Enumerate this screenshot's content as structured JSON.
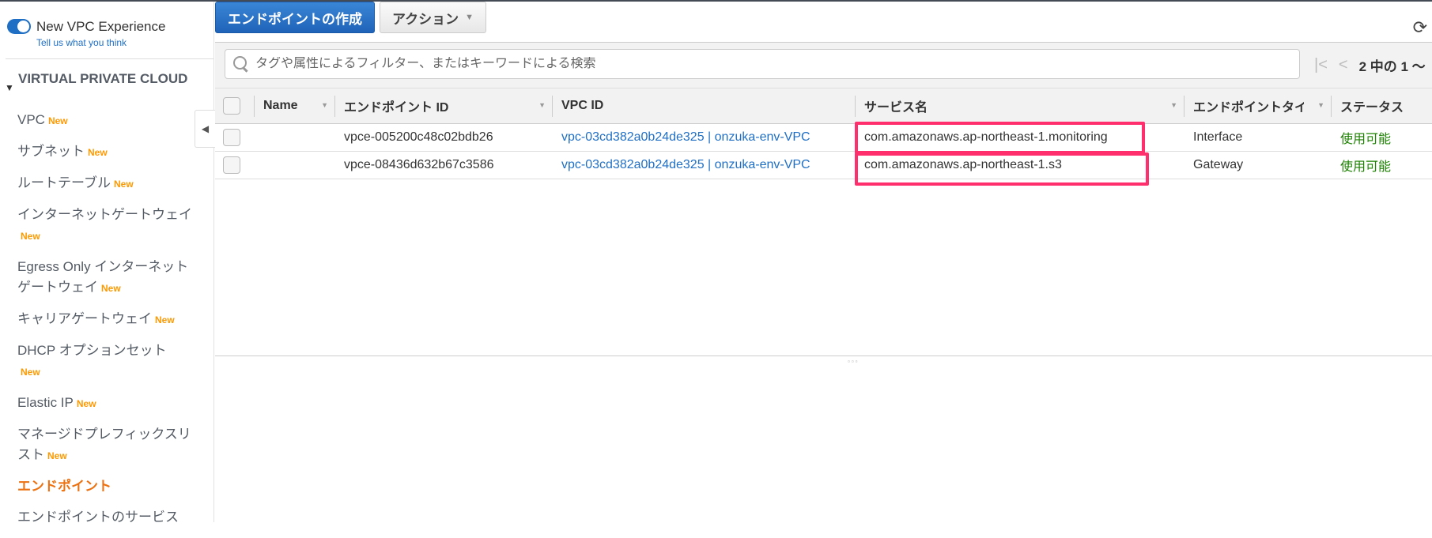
{
  "sidebar": {
    "experience_label": "New VPC Experience",
    "feedback_link": "Tell us what you think",
    "section_title": "VIRTUAL PRIVATE CLOUD",
    "new_badge": "New",
    "items": [
      {
        "label": "VPC",
        "new": true
      },
      {
        "label": "サブネット",
        "new": true
      },
      {
        "label": "ルートテーブル",
        "new": true
      },
      {
        "label": "インターネットゲートウェイ",
        "new": true
      },
      {
        "label": "Egress Only インターネットゲートウェイ",
        "new": true
      },
      {
        "label": "キャリアゲートウェイ",
        "new": true
      },
      {
        "label": "DHCP オプションセット",
        "new": true,
        "badge_wrap": true
      },
      {
        "label": "Elastic IP",
        "new": true
      },
      {
        "label": "マネージドプレフィックスリスト",
        "new": true
      },
      {
        "label": "エンドポイント",
        "new": false,
        "active": true
      },
      {
        "label": "エンドポイントのサービス",
        "new": false
      }
    ]
  },
  "toolbar": {
    "create_label": "エンドポイントの作成",
    "actions_label": "アクション",
    "search_placeholder": "タグや属性によるフィルター、またはキーワードによる検索",
    "pagination": "2 中の 1 〜"
  },
  "table": {
    "columns": [
      "Name",
      "エンドポイント ID",
      "VPC ID",
      "サービス名",
      "エンドポイントタイプ",
      "ステータス"
    ],
    "rows": [
      {
        "name": "",
        "id": "vpce-005200c48c02bdb26",
        "vpc": "vpc-03cd382a0b24de325 | onzuka-env-VPC",
        "service": "com.amazonaws.ap-northeast-1.monitoring",
        "type": "Interface",
        "status": "使用可能"
      },
      {
        "name": "",
        "id": "vpce-08436d632b67c3586",
        "vpc": "vpc-03cd382a0b24de325 | onzuka-env-VPC",
        "service": "com.amazonaws.ap-northeast-1.s3",
        "type": "Gateway",
        "status": "使用可能"
      }
    ]
  },
  "colors": {
    "primary": "#2a73c8",
    "active_nav": "#ec7211",
    "new_badge": "#ff9900",
    "status_ok": "#1d8102",
    "highlight": "#ff2f6e"
  }
}
